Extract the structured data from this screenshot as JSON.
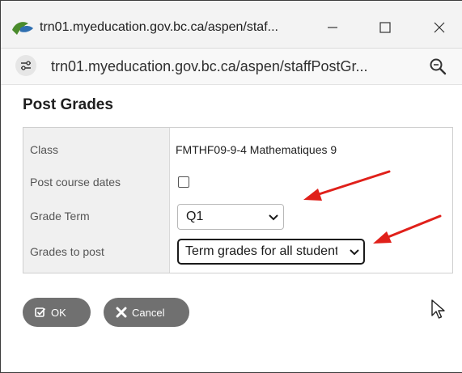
{
  "window": {
    "title": "trn01.myeducation.gov.bc.ca/aspen/staf...",
    "url": "trn01.myeducation.gov.bc.ca/aspen/staffPostGr...",
    "controls": {
      "minimize_icon": "minimize-icon",
      "maximize_icon": "maximize-icon",
      "close_icon": "close-icon"
    },
    "zoom_icon": "zoom-icon",
    "site_settings_icon": "site-settings-icon"
  },
  "dialog": {
    "title": "Post Grades",
    "rows": [
      {
        "label": "Class",
        "value": "FMTHF09-9-4  Mathematiques 9"
      },
      {
        "label": "Post course dates",
        "checked": false
      },
      {
        "label": "Grade Term",
        "selected": "Q1"
      },
      {
        "label": "Grades to post",
        "selected": "Term grades for all students"
      }
    ],
    "buttons": {
      "ok_label": "OK",
      "cancel_label": "Cancel"
    }
  },
  "colors": {
    "annotation_arrow": "#e0201a",
    "button_bg": "#707070",
    "label_column_bg": "#f0f0f0"
  }
}
